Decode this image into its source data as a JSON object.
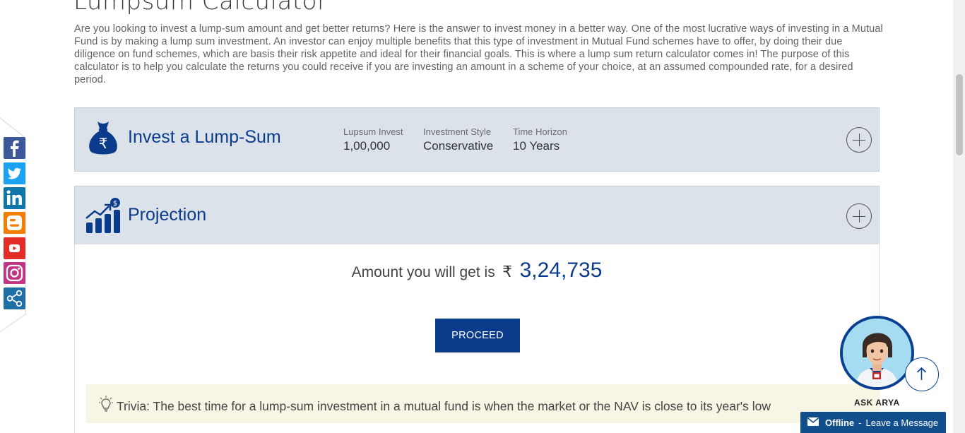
{
  "page": {
    "title": "Lumpsum Calculator",
    "intro": "Are you looking to invest a lump-sum amount and get better returns? Here is the answer to invest money in a better way. One of the most lucrative ways of investing in a Mutual Fund is by making a lump sum investment. An investor can enjoy multiple benefits that this type of investment in Mutual Fund schemes have to offer, by doing their due diligence on fund schemes, which are basis their risk appetite and ideal for their financial goals. This is where a lump sum return calculator comes in! The purpose of this calculator is to help you calculate the returns you could receive if you are investing an amount in a scheme of your choice, at an assumed compounded rate, for a desired period."
  },
  "invest_panel": {
    "title": "Invest a Lump-Sum",
    "stats": [
      {
        "label": "Lupsum Invest",
        "value": "1,00,000"
      },
      {
        "label": "Investment Style",
        "value": "Conservative"
      },
      {
        "label": "Time Horizon",
        "value": "10 Years"
      }
    ]
  },
  "projection_panel": {
    "title": "Projection",
    "amount_label": "Amount you will get is",
    "currency_symbol": "₹",
    "amount_value": "3,24,735",
    "proceed_label": "PROCEED",
    "trivia": "Trivia: The best time for a lump-sum investment in a mutual fund is when the market or the NAV is close to its year's low"
  },
  "chat": {
    "assistant_label": "ASK ARYA",
    "status": "Offline",
    "separator": "-",
    "message": "Leave a Message"
  },
  "social_icons": [
    "facebook-icon",
    "twitter-icon",
    "linkedin-icon",
    "blogger-icon",
    "youtube-icon",
    "instagram-icon",
    "share-icon"
  ],
  "colors": {
    "brand_blue": "#0b3c8c",
    "panel_bg": "#dbe2e9",
    "trivia_bg": "#f7f5e4",
    "facebook": "#3b5998",
    "twitter": "#1da1f2",
    "linkedin": "#0e76a8",
    "blogger": "#f57d00",
    "youtube": "#e52d27",
    "instagram": "#c13584",
    "share": "#1d6fa5"
  }
}
